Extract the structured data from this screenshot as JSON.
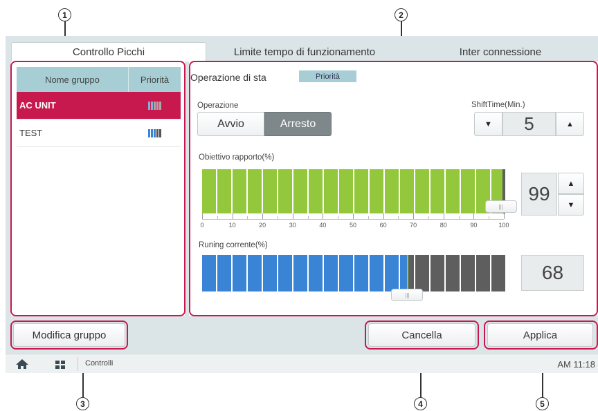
{
  "callouts": [
    "1",
    "2",
    "3",
    "4",
    "5"
  ],
  "tabs": [
    "Controllo Picchi",
    "Limite tempo di funzionamento",
    "Inter connessione"
  ],
  "group_table": {
    "col_name": "Nome gruppo",
    "col_priority": "Priorità",
    "rows": [
      {
        "name": "AC UNIT",
        "selected": true
      },
      {
        "name": "TEST",
        "selected": false
      }
    ]
  },
  "right_panel": {
    "title": "Operazione di sta",
    "priority_badge": "Priorità",
    "operation_label": "Operazione",
    "start_button": "Avvio",
    "stop_button": "Arresto",
    "shift_label": "ShiftTime(Min.)",
    "shift_value": "5",
    "target_label": "Obiettivo rapporto(%)",
    "target_value": "99",
    "target_percent": 99,
    "scale_ticks": [
      "0",
      "10",
      "20",
      "30",
      "40",
      "50",
      "60",
      "70",
      "80",
      "90",
      "100"
    ],
    "current_label": "Runing corrente(%)",
    "current_value": "68",
    "current_percent": 68
  },
  "buttons": {
    "edit_group": "Modifica gruppo",
    "cancel": "Cancella",
    "apply": "Applica"
  },
  "taskbar": {
    "section": "Controlli",
    "time": "AM 11:18"
  },
  "colors": {
    "accent": "#c8194e",
    "target_fill": "#93c73c",
    "current_fill": "#3a84d6",
    "empty_fill": "#5e5e5e",
    "header_bg": "#a7ced4"
  }
}
